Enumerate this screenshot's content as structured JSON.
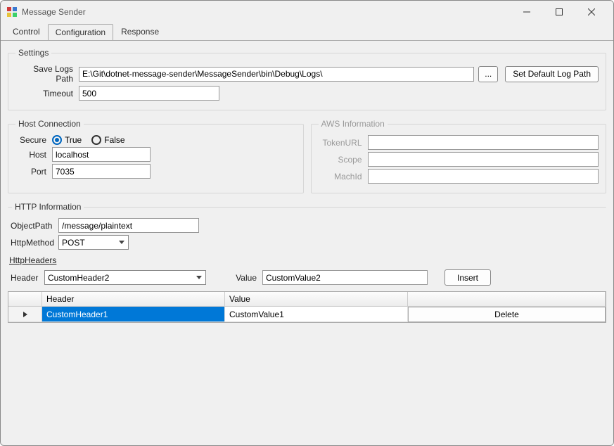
{
  "window": {
    "title": "Message Sender"
  },
  "tabs": {
    "control": "Control",
    "configuration": "Configuration",
    "response": "Response",
    "active": "configuration"
  },
  "settings": {
    "legend": "Settings",
    "save_logs_path_label": "Save Logs Path",
    "save_logs_path_value": "E:\\Git\\dotnet-message-sender\\MessageSender\\bin\\Debug\\Logs\\",
    "browse_button": "...",
    "set_default_button": "Set Default Log Path",
    "timeout_label": "Timeout",
    "timeout_value": "500"
  },
  "host_connection": {
    "legend": "Host Connection",
    "secure_label": "Secure",
    "secure_true": "True",
    "secure_false": "False",
    "secure_value": true,
    "host_label": "Host",
    "host_value": "localhost",
    "port_label": "Port",
    "port_value": "7035"
  },
  "aws": {
    "legend": "AWS Information",
    "tokenurl_label": "TokenURL",
    "tokenurl_value": "",
    "scope_label": "Scope",
    "scope_value": "",
    "machid_label": "MachId",
    "machid_value": ""
  },
  "http_info": {
    "legend": "HTTP Information",
    "objectpath_label": "ObjectPath",
    "objectpath_value": "/message/plaintext",
    "httpmethod_label": "HttpMethod",
    "httpmethod_value": "POST"
  },
  "http_headers": {
    "section_label": "HttpHeaders",
    "header_label": "Header",
    "header_input_value": "CustomHeader2",
    "value_label": "Value",
    "value_input_value": "CustomValue2",
    "insert_button": "Insert",
    "grid": {
      "col_rowhdr_width": 48,
      "col_header": "Header",
      "col_value": "Value",
      "col_action": "",
      "rows": [
        {
          "header": "CustomHeader1",
          "value": "CustomValue1",
          "action": "Delete",
          "selected": true
        }
      ]
    }
  }
}
